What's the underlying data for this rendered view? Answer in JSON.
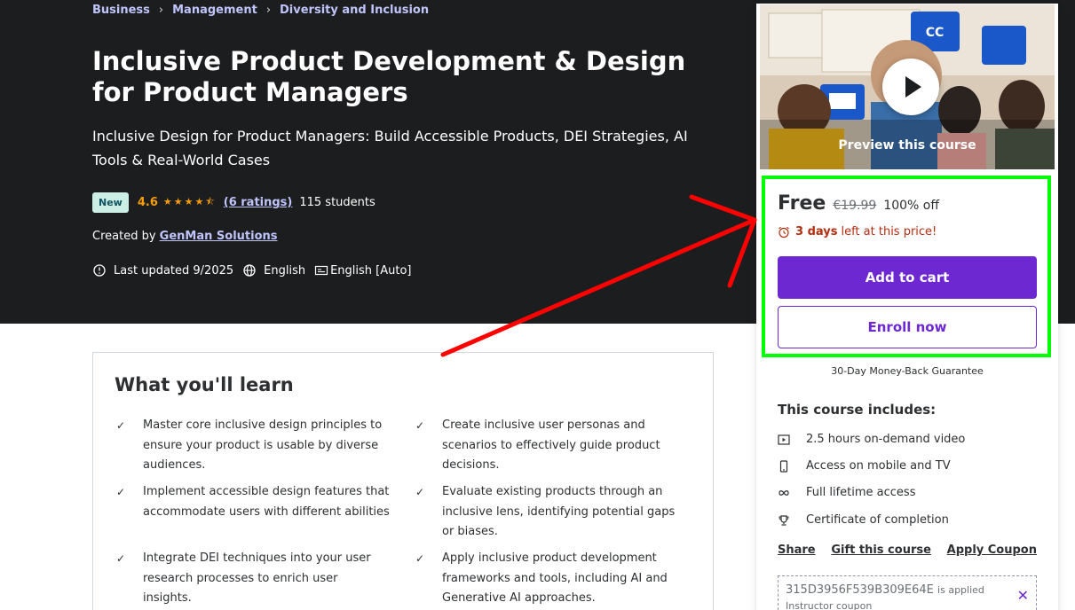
{
  "breadcrumb": [
    "Business",
    "Management",
    "Diversity and Inclusion"
  ],
  "course": {
    "title": "Inclusive Product Development & Design for Product Managers",
    "subtitle": "Inclusive Design for Product Managers: Build Accessible Products, DEI Strategies, AI Tools & Real-World Cases",
    "badge": "New",
    "rating": "4.6",
    "rating_stars": 4.5,
    "ratings_count": "(6 ratings)",
    "students": "115 students",
    "created_by_label": "Created by",
    "instructor": "GenMan Solutions",
    "last_updated": "Last updated 9/2025",
    "language": "English",
    "captions": "English [Auto]"
  },
  "learn": {
    "title": "What you'll learn",
    "items": [
      "Master core inclusive design principles to ensure your product is usable by diverse audiences.",
      "Create inclusive user personas and scenarios to effectively guide product decisions.",
      "Implement accessible design features that accommodate users with different abilities",
      "Evaluate existing products through an inclusive lens, identifying potential gaps or biases.",
      "Integrate DEI techniques into your user research processes to enrich user insights.",
      "Apply inclusive product development frameworks and tools, including AI and Generative AI approaches."
    ]
  },
  "sidebar": {
    "preview_label": "Preview this course",
    "price": "Free",
    "original_price": "€19.99",
    "discount": "100% off",
    "timer_bold": "3 days",
    "timer_rest": "left at this price!",
    "add_to_cart": "Add to cart",
    "enroll_now": "Enroll now",
    "guarantee": "30-Day Money-Back Guarantee",
    "includes_title": "This course includes:",
    "includes": [
      {
        "icon": "video-icon",
        "text": "2.5 hours on-demand video"
      },
      {
        "icon": "mobile-icon",
        "text": "Access on mobile and TV"
      },
      {
        "icon": "infinity-icon",
        "text": "Full lifetime access"
      },
      {
        "icon": "trophy-icon",
        "text": "Certificate of completion"
      }
    ],
    "links": {
      "share": "Share",
      "gift": "Gift this course",
      "coupon": "Apply Coupon"
    },
    "coupon_code": "315D3956F539B309E64E",
    "coupon_applied": "is applied",
    "coupon_sub": "Instructor coupon"
  },
  "colors": {
    "hero_bg": "#1c1d1f",
    "accent": "#6d28d2",
    "link": "#c0c4fc",
    "star": "#f69c08",
    "highlight": "#00ff00",
    "arrow": "#ff0000"
  }
}
